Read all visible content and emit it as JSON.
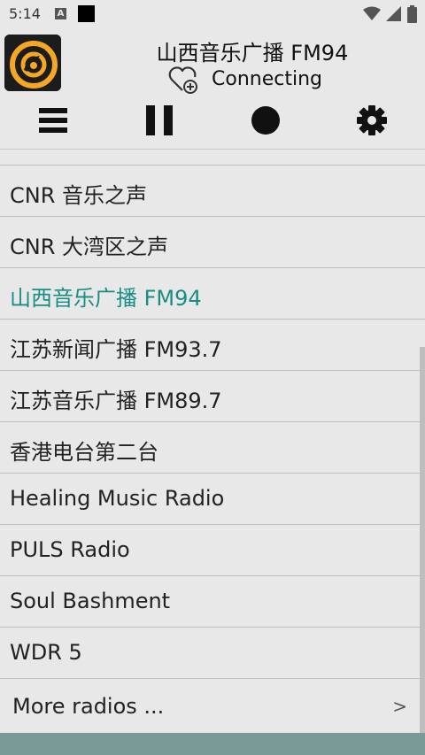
{
  "status_bar": {
    "time": "5:14",
    "a_icon": "A",
    "icons": [
      "a-notification-icon",
      "square-notification-icon",
      "wifi-icon",
      "signal-icon",
      "battery-icon"
    ]
  },
  "header": {
    "station_title": "山西音乐广播 FM94",
    "status": "Connecting",
    "favorite_icon": "heart-plus-icon"
  },
  "toolbar": {
    "buttons": [
      "menu-icon",
      "pause-icon",
      "record-icon",
      "gear-icon"
    ]
  },
  "stations": [
    {
      "label": "CNR 音乐之声"
    },
    {
      "label": "CNR 大湾区之声"
    },
    {
      "label": "山西音乐广播 FM94"
    },
    {
      "label": "江苏新闻广播 FM93.7"
    },
    {
      "label": "江苏音乐广播 FM89.7"
    },
    {
      "label": "香港电台第二台"
    },
    {
      "label": "Healing Music Radio"
    },
    {
      "label": "PULS Radio"
    },
    {
      "label": "Soul Bashment"
    },
    {
      "label": "WDR 5"
    }
  ],
  "active_index": 2,
  "more": {
    "label": "More radios ...",
    "arrow": ">"
  },
  "colors": {
    "accent": "#178d84",
    "background": "#e8e8e8",
    "bottom_bar": "#7a9a98",
    "logo_orange": "#f5a623"
  }
}
